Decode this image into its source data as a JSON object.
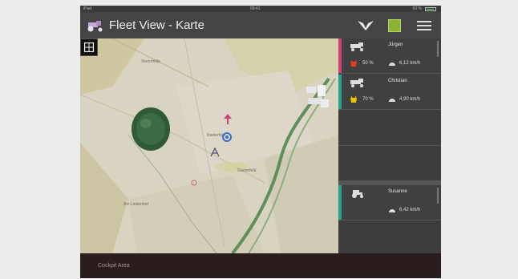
{
  "statusbar": {
    "carrier": "iPad",
    "time": "09:41",
    "battery": "63 %"
  },
  "header": {
    "title": "Fleet View - Karte"
  },
  "icons": {
    "app_logo": "tractor-logo-icon",
    "brand": "wing-logo-icon",
    "layers": "field-layer-icon",
    "menu": "hamburger-menu-icon",
    "north": "north-arrow-icon",
    "fields": "field-boundary-icon",
    "compass": "compass-icon"
  },
  "map": {
    "labels": [
      "Viererfelde",
      "Niederfeld",
      "Gartenfeld",
      "Am Lindenhof"
    ]
  },
  "vehicles": [
    {
      "name": "Jürgen",
      "fuel": "50 %",
      "speed": "6,12 km/h",
      "color": "#d0417a",
      "fuel_color": "#e03c2a"
    },
    {
      "name": "Christian",
      "fuel": "70 %",
      "speed": "4,90 km/h",
      "color": "#2aa08c",
      "fuel_color": "#f2c200"
    },
    {
      "name": "Susanne",
      "fuel": "",
      "speed": "6,42 km/h",
      "color": "#2aa08c",
      "fuel_color": ""
    }
  ],
  "footer": {
    "label": "Cockpit Area"
  }
}
